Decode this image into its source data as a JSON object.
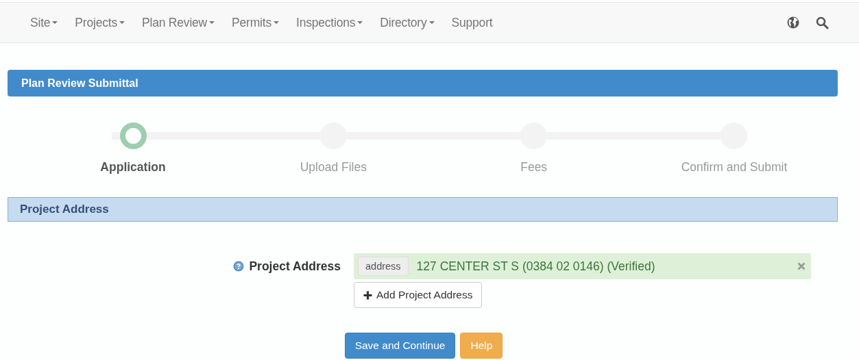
{
  "nav": {
    "items": [
      {
        "label": "Site",
        "dropdown": true
      },
      {
        "label": "Projects",
        "dropdown": true
      },
      {
        "label": "Plan Review",
        "dropdown": true
      },
      {
        "label": "Permits",
        "dropdown": true
      },
      {
        "label": "Inspections",
        "dropdown": true
      },
      {
        "label": "Directory",
        "dropdown": true
      },
      {
        "label": "Support",
        "dropdown": false
      }
    ]
  },
  "panel": {
    "title": "Plan Review Submittal"
  },
  "steps": [
    {
      "label": "Application",
      "selected": true
    },
    {
      "label": "Upload Files",
      "selected": false
    },
    {
      "label": "Fees",
      "selected": false
    },
    {
      "label": "Confirm and Submit",
      "selected": false
    }
  ],
  "section": {
    "title": "Project Address"
  },
  "address_field": {
    "label": "Project Address",
    "tag": "address",
    "value": "127 CENTER ST S (0384 02 0146) (Verified)",
    "verified": true
  },
  "add_button": "Add Project Address",
  "buttons": [
    {
      "label": "Save and Continue",
      "kind": "primary"
    },
    {
      "label": "Help",
      "kind": "warning"
    }
  ]
}
